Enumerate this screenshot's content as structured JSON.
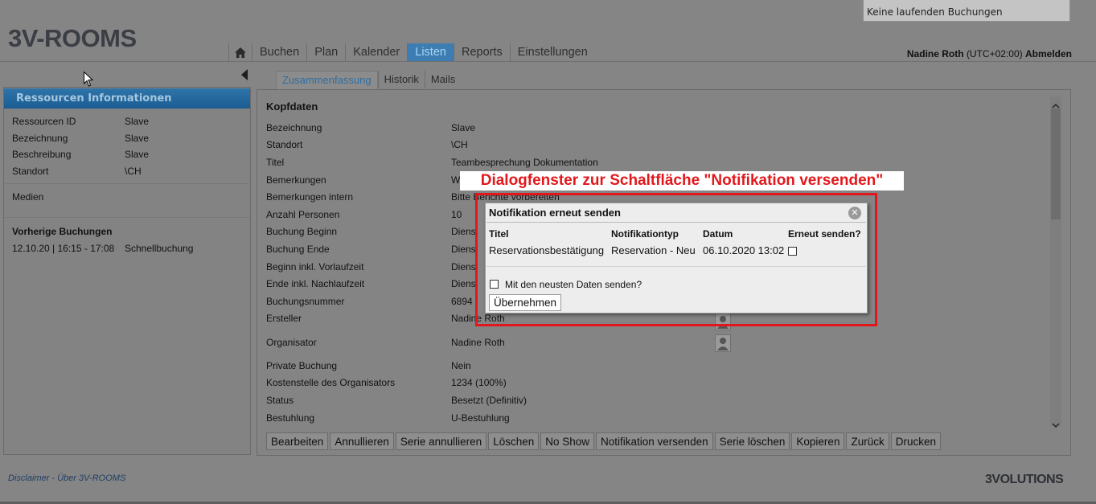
{
  "app": {
    "logo": "3V-ROOMS",
    "status": "Keine laufenden Buchungen",
    "user_name": "Nadine Roth",
    "user_tz": "(UTC+02:00)",
    "logout": "Abmelden"
  },
  "nav": {
    "items": [
      {
        "label": "Buchen",
        "active": false
      },
      {
        "label": "Plan",
        "active": false
      },
      {
        "label": "Kalender",
        "active": false
      },
      {
        "label": "Listen",
        "active": true
      },
      {
        "label": "Reports",
        "active": false
      },
      {
        "label": "Einstellungen",
        "active": false
      }
    ]
  },
  "left": {
    "title": "Ressourcen Informationen",
    "rows": [
      {
        "label": "Ressourcen ID",
        "value": "Slave"
      },
      {
        "label": "Bezeichnung",
        "value": "Slave"
      },
      {
        "label": "Beschreibung",
        "value": "Slave"
      },
      {
        "label": "Standort",
        "value": "\\CH"
      }
    ],
    "media": "Medien",
    "prev_title": "Vorherige Buchungen",
    "prev_date": "12.10.20 | 16:15 - 17:08",
    "prev_type": "Schnellbuchung"
  },
  "tabs": [
    "Zusammenfassung",
    "Historik",
    "Mails"
  ],
  "main": {
    "section": "Kopfdaten",
    "rows": [
      {
        "label": "Bezeichnung",
        "value": "Slave"
      },
      {
        "label": "Standort",
        "value": "\\CH"
      },
      {
        "label": "Titel",
        "value": "Teambesprechung Dokumentation"
      },
      {
        "label": "Bemerkungen",
        "value": "W"
      },
      {
        "label": "Bemerkungen intern",
        "value": "Bitte Berichte vorbereiten"
      },
      {
        "label": "Anzahl Personen",
        "value": "10"
      },
      {
        "label": "Buchung Beginn",
        "value": "Diens"
      },
      {
        "label": "Buchung Ende",
        "value": "Diens"
      },
      {
        "label": "Beginn inkl. Vorlaufzeit",
        "value": "Diens"
      },
      {
        "label": "Ende inkl. Nachlaufzeit",
        "value": "Diens"
      },
      {
        "label": "Buchungsnummer",
        "value": "6894"
      },
      {
        "label": "Ersteller",
        "value": "Nadine Roth"
      },
      {
        "label": "Organisator",
        "value": "Nadine Roth"
      },
      {
        "label": "Private Buchung",
        "value": "Nein"
      },
      {
        "label": "Kostenstelle des Organisators",
        "value": "1234 (100%)"
      },
      {
        "label": "Status",
        "value": "Besetzt (Definitiv)"
      },
      {
        "label": "Bestuhlung",
        "value": "U-Bestuhlung"
      }
    ]
  },
  "buttons": [
    "Bearbeiten",
    "Annullieren",
    "Serie annullieren",
    "Löschen",
    "No Show",
    "Notifikation versenden",
    "Serie löschen",
    "Kopieren",
    "Zurück",
    "Drucken"
  ],
  "annotation": "Dialogfenster zur Schaltfläche \"Notifikation versenden\"",
  "dialog": {
    "title": "Notifikation erneut senden",
    "headers": [
      "Titel",
      "Notifikationtyp",
      "Datum",
      "Erneut senden?"
    ],
    "row": {
      "title": "Reservationsbestätigung",
      "type": "Reservation - Neu",
      "date": "06.10.2020 13:02"
    },
    "latest_data_label": "Mit den neusten Daten senden?",
    "apply": "Übernehmen"
  },
  "footer": {
    "links": "Disclaimer  -  Über 3V-ROOMS",
    "logo": "3VOLUTIONS"
  },
  "colors": {
    "accent": "#3d7db2",
    "annotation_red": "#e3161b"
  }
}
